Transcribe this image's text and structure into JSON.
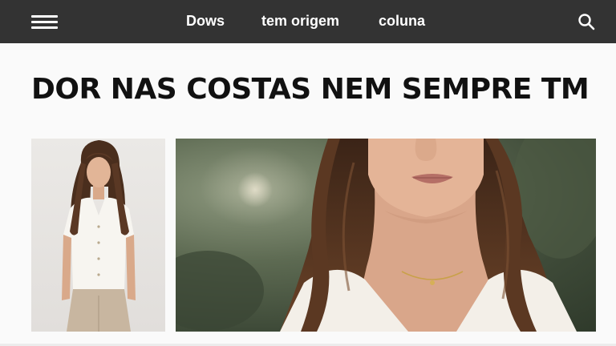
{
  "header": {
    "menu_icon": "hamburger-menu-icon",
    "nav": [
      {
        "label": "Dows"
      },
      {
        "label": "tem origem"
      },
      {
        "label": "coluna"
      }
    ],
    "search_icon": "search-icon",
    "colors": {
      "bar": "#333333",
      "text": "#ffffff"
    }
  },
  "article": {
    "headline": "DOR NAS COSTAS NEM SEMPRE TM"
  },
  "images": {
    "left": "full-body-photo-woman",
    "right": "close-up-photo-woman"
  },
  "colors": {
    "page_background": "#fafafa",
    "headline": "#111111"
  }
}
